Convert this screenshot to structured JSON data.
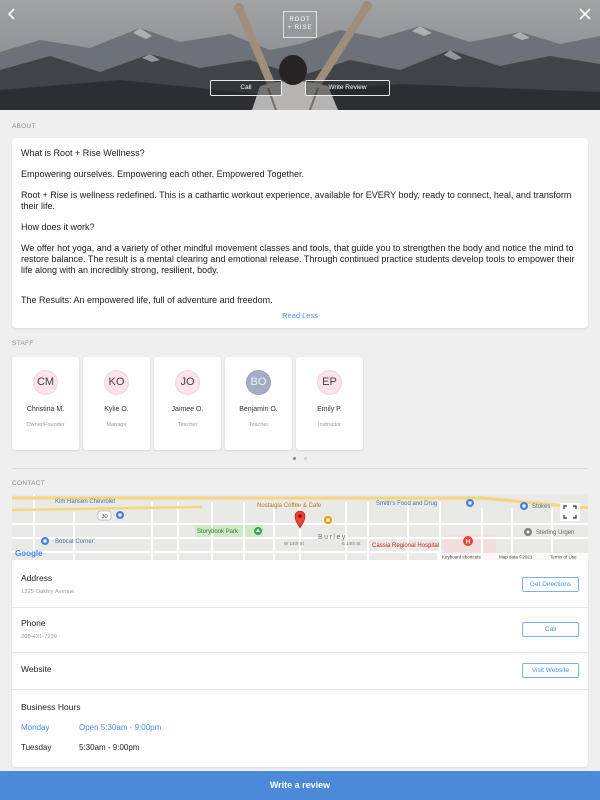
{
  "theme": {
    "accent": "#4a90e2",
    "cta_bar": "#4a8ad8",
    "page_bg": "#efefef"
  },
  "header": {
    "back_icon": "chevron-left-icon",
    "close_icon": "close-icon",
    "logo_top": "ROOT",
    "logo_bottom": "+ RISE",
    "call_label": "Call",
    "write_review_label": "Write Review"
  },
  "about": {
    "section_label": "ABOUT",
    "paragraphs": [
      "What is Root + Rise Wellness?",
      "Empowering ourselves.  Empowering each other. Empowered Together.",
      "Root + Rise is wellness redefined. This is a cathartic workout experience, available for EVERY body, ready to connect, heal, and transform their life.",
      "How does it work?",
      "We offer hot yoga, and a variety of other mindful movement classes and tools, that guide you to strengthen the body and notice the mind to restore balance. The result is a mental clearing and emotional release.  Through continued practice students develop tools to empower their life along with an incredibly strong, resilient, body.",
      "The Results: An empowered life, full of adventure and freedom."
    ],
    "read_less": "Read Less"
  },
  "staff": {
    "section_label": "STAFF",
    "members": [
      {
        "initials": "CM",
        "name": "Christina M.",
        "role": "Owner/Founder",
        "avatar_color": "#fde4ea",
        "initials_color": "#444444"
      },
      {
        "initials": "KO",
        "name": "Kylie O.",
        "role": "Manage",
        "avatar_color": "#fde4ea",
        "initials_color": "#444444"
      },
      {
        "initials": "JO",
        "name": "Jaimee O.",
        "role": "Teacher",
        "avatar_color": "#fde4ea",
        "initials_color": "#444444"
      },
      {
        "initials": "BO",
        "name": "Benjamin O.",
        "role": "Teacher",
        "avatar_color": "#a4adc6",
        "initials_color": "#f2f3f7"
      },
      {
        "initials": "EP",
        "name": "Emily P.",
        "role": "Instructor",
        "avatar_color": "#fde4ea",
        "initials_color": "#444444"
      }
    ],
    "pagination": {
      "pages": 2,
      "active": 0
    }
  },
  "contact": {
    "section_label": "CONTACT",
    "map": {
      "route_shield": "30",
      "town": "Burley",
      "streets": {
        "w14": "W 14th St",
        "e14": "E 14th St"
      },
      "places": {
        "kim_hansen": "Kim Hansen Chevrolet",
        "nostalgia": "Nostalgia Coffee & Cafe",
        "smiths": "Smith's Food and Drug",
        "stokes": "Stokes",
        "bobcat": "Bobcat Corner",
        "storybook": "Storybook Park",
        "cassia": "Cassia Regional Hospital",
        "sterling": "Sterling Urgen"
      },
      "google_logo": "Google",
      "keyboard_shortcuts": "Keyboard shortcuts",
      "map_data": "Map data ©2021",
      "terms": "Terms of Use",
      "fullscreen_icon": "fullscreen-icon",
      "pin_icon": "location-pin-icon"
    },
    "address": {
      "label": "Address",
      "value": "1325 Oakley Avenue",
      "button": "Get Directions"
    },
    "phone": {
      "label": "Phone",
      "value": "208-431-7239",
      "button": "Call"
    },
    "website": {
      "label": "Website",
      "button": "Visit Website"
    },
    "hours": {
      "title": "Business Hours",
      "days": [
        {
          "day": "Monday",
          "hours": "Open 5:30am - 9:00pm",
          "highlighted": true
        },
        {
          "day": "Tuesday",
          "hours": "5:30am - 9:00pm",
          "highlighted": false
        }
      ]
    }
  },
  "footer": {
    "write_review_label": "Write a review"
  }
}
